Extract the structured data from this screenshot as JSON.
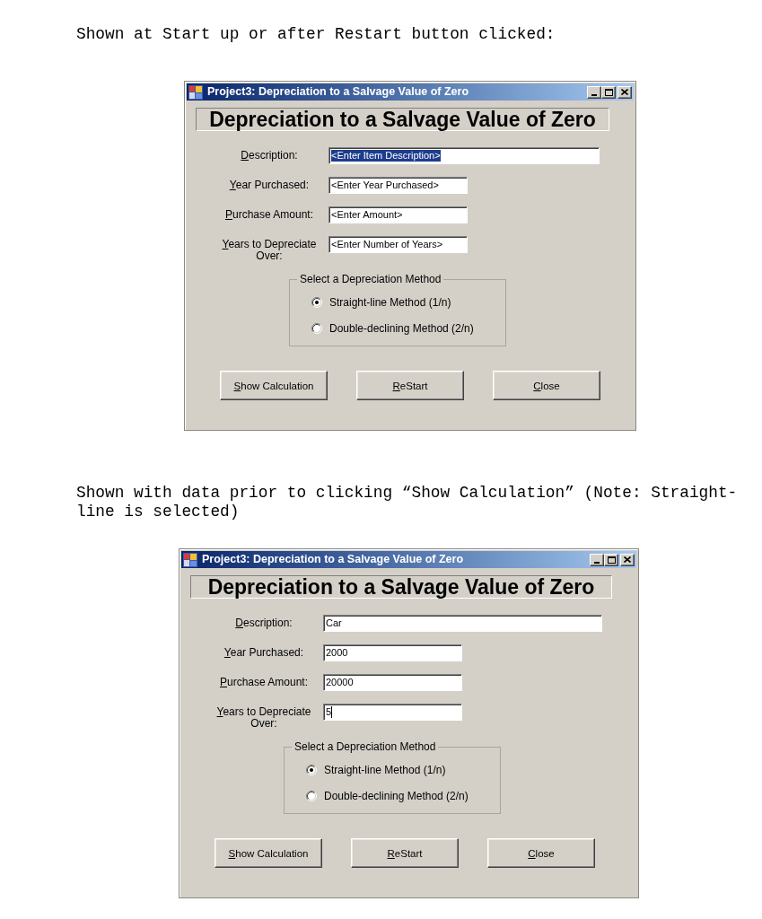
{
  "sections": [
    {
      "caption": "Shown at Start up or after Restart button clicked:",
      "window": {
        "title": "Project3: Depreciation to a Salvage Value of Zero",
        "heading": "Depreciation to a Salvage Value of Zero",
        "fields": [
          {
            "label": "Description:",
            "value": "<Enter Item Description>",
            "highlighted": true,
            "caret": false
          },
          {
            "label": "Year Purchased:",
            "value": "<Enter Year Purchased>",
            "highlighted": false,
            "caret": false
          },
          {
            "label": "Purchase Amount:",
            "value": "<Enter Amount>",
            "highlighted": false,
            "caret": false
          },
          {
            "label": "Years to Depreciate Over:",
            "value": "<Enter Number of Years>",
            "highlighted": false,
            "caret": false
          }
        ],
        "method_group": {
          "legend": "Select a Depreciation Method",
          "options": [
            {
              "label": "Straight-line Method (1/n)",
              "selected": true
            },
            {
              "label": "Double-declining Method (2/n)",
              "selected": false
            }
          ]
        },
        "buttons": [
          "Show Calculation",
          "ReStart",
          "Close"
        ]
      }
    },
    {
      "caption": "Shown with data prior to clicking “Show Calculation” (Note: Straight-line is selected)",
      "window": {
        "title": "Project3: Depreciation to a Salvage Value of Zero",
        "heading": "Depreciation to a Salvage Value of Zero",
        "fields": [
          {
            "label": "Description:",
            "value": "Car",
            "highlighted": false,
            "caret": false
          },
          {
            "label": "Year Purchased:",
            "value": "2000",
            "highlighted": false,
            "caret": false
          },
          {
            "label": "Purchase Amount:",
            "value": "20000",
            "highlighted": false,
            "caret": false
          },
          {
            "label": "Years to Depreciate Over:",
            "value": "5",
            "highlighted": false,
            "caret": true
          }
        ],
        "method_group": {
          "legend": "Select a Depreciation Method",
          "options": [
            {
              "label": "Straight-line Method (1/n)",
              "selected": true
            },
            {
              "label": "Double-declining Method (2/n)",
              "selected": false
            }
          ]
        },
        "buttons": [
          "Show Calculation",
          "ReStart",
          "Close"
        ]
      }
    }
  ]
}
